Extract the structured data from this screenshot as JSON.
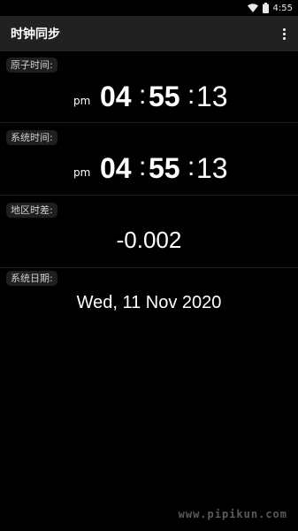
{
  "statusbar": {
    "time": "4:55",
    "wifi_icon": "wifi-icon",
    "battery_icon": "battery-icon"
  },
  "appbar": {
    "title": "时钟同步",
    "menu_icon": "more-vert-icon"
  },
  "atomic_time": {
    "label": "原子时间:",
    "ampm": "pm",
    "hours": "04",
    "minutes": "55",
    "seconds": "13",
    "separator": ":"
  },
  "system_time": {
    "label": "系统时间:",
    "ampm": "pm",
    "hours": "04",
    "minutes": "55",
    "seconds": "13",
    "separator": ":"
  },
  "offset": {
    "label": "地区时差:",
    "value": "-0.002"
  },
  "system_date": {
    "label": "系统日期:",
    "value": "Wed, 11 Nov 2020"
  },
  "watermark": "www.pipikun.com",
  "colors": {
    "background": "#000000",
    "appbar": "#212121",
    "label_bg": "#1f1f1f",
    "text": "#ffffff"
  }
}
